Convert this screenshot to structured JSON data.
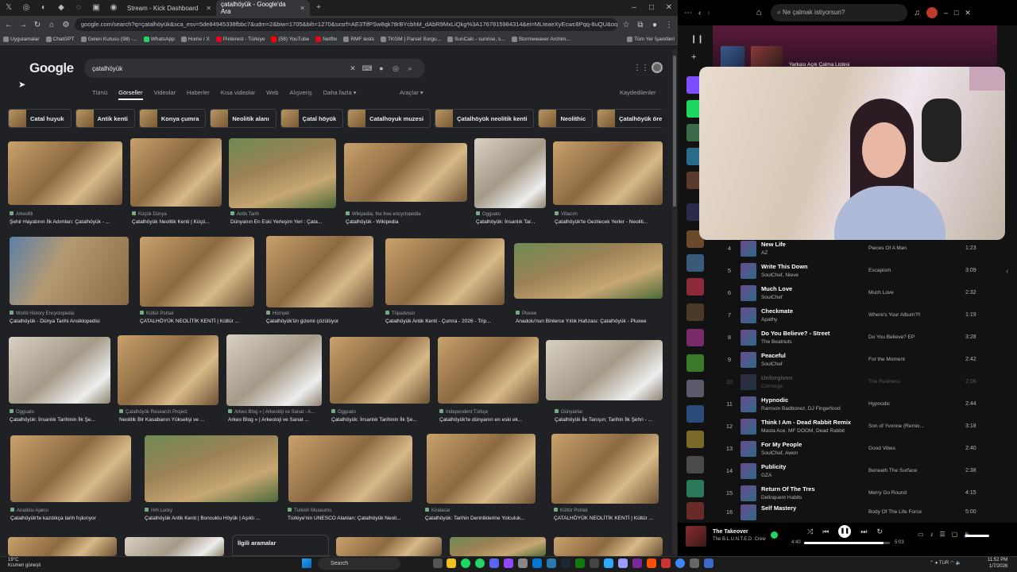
{
  "browser": {
    "tabs": [
      {
        "label": "Stream - Kick Dashboard"
      },
      {
        "label": "çatalhöyük - Google'da Ara"
      }
    ],
    "url": "google.com/search?q=çatalhöyük&sca_esv=5de84945338fbbc7&udm=2&biw=1705&bih=1270&sxsrf=AE3TifPSw8qk78rBYcbhM_dAbR9MxLiQkg%3A1767815984314&ei=MLteaeXyEcwc8Pqq-8uQU&oq=çatalh...",
    "bookmarks": [
      "Uygulamalar",
      "ChatGPT",
      "Gelen Kutusu (98) -...",
      "WhatsApp",
      "Home / X",
      "Pinterest - Türkiye",
      "(58) YouTube",
      "Netflix",
      "RMF tests",
      "TKGM | Parsel Sorgu...",
      "SunCalc - sunrise, s...",
      "Stormweaver Archim...",
      "Tüm Yer İşaretleri"
    ]
  },
  "google": {
    "logo": "Google",
    "query": "çatalhöyük",
    "tabs": [
      "Tümü",
      "Görseller",
      "Videolar",
      "Haberler",
      "Kısa videolar",
      "Web",
      "Alışveriş",
      "Daha fazla ▾"
    ],
    "tools": "Araçlar ▾",
    "saved": "Kaydedilenler",
    "chips": [
      "Catal huyuk",
      "Antik kenti",
      "Konya çumra",
      "Neolitik alanı",
      "Çatal höyük",
      "Catalhoyuk muzesi",
      "Çatalhöyük neolitik kenti",
      "Neolithic",
      "Çatalhöyük örenyeri"
    ],
    "results": [
      {
        "src": "Arkeofili",
        "title": "Şehir Hayatının İlk Adımları: Çatalhöyük - ..."
      },
      {
        "src": "Küçük Dünya",
        "title": "Çatalhöyük Neolitik Kenti | Küçü..."
      },
      {
        "src": "Antik Tarih",
        "title": "Dünyanın En Eski Yerleşim Yeri : Çata..."
      },
      {
        "src": "Wikipedia, the free encyclopedia",
        "title": "Çatalhöyük - Wikipedia"
      },
      {
        "src": "Ogguato",
        "title": "Çatalhöyük: İnsanlık Tar..."
      },
      {
        "src": "Villacım",
        "title": "Çatalhöyük'te Gezilecek Yerler - Neoliti..."
      },
      {
        "src": "World History Encyclopedia",
        "title": "Çatalhöyük - Dünya Tarihi Ansiklopedisi"
      },
      {
        "src": "Kültür Portalı",
        "title": "ÇATALHÖYÜK NEOLİTİK KENTİ | Kültür ..."
      },
      {
        "src": "Hürriyet",
        "title": "Çatalhöyük'ün gizemi çözülüyor"
      },
      {
        "src": "Tripadvisor",
        "title": "Çatalhöyük Antik Kenti - Çumra - 2026 - Trip..."
      },
      {
        "src": "Pluxee",
        "title": "Anadolu'nun Binlerce Yıllık Hafızası: Çatalhöyük - Pluxee"
      },
      {
        "src": "Ogguato",
        "title": "Çatalhöyük: İnsanlık Tarihinin İlk Şe..."
      },
      {
        "src": "Çatalhöyük Research Project",
        "title": "Neolitik Bir Kasabanın Yükselişi ve ..."
      },
      {
        "src": "Arkeo Blog » | Arkeoloji ve Sanat - A...",
        "title": "Arkeo Blog » | Arkeoloji ve Sanat ..."
      },
      {
        "src": "Ogguato",
        "title": "Çatalhöyük: İnsanlık Tarihinin İlk Şe..."
      },
      {
        "src": "Independent Türkçe",
        "title": "Çatalhöyük'te dünyanın en eski ek..."
      },
      {
        "src": "Günyalılar",
        "title": "Çatalhöyük İle Tanışın; Tarihin İlk Şehri - ..."
      },
      {
        "src": "Anadolu Ajansı",
        "title": "Çatalhöyük'te kazdıkça tarih fışkırıyor"
      },
      {
        "src": "Hrh Lucky",
        "title": "Çatalhöyük Antik Kenti | Boncuklu Höyük | Aşıklı ..."
      },
      {
        "src": "Turkish Museums",
        "title": "Türkiye'nin UNESCO Alanları: Çatalhöyük Neoli..."
      },
      {
        "src": "Kiralacar",
        "title": "Çatalhöyük: Tarihin Derinliklerine Yolculuk..."
      },
      {
        "src": "Kültür Portalı",
        "title": "ÇATALHÖYÜK NEOLİTİK KENTİ | Kültür ..."
      }
    ],
    "related": "İlgili aramalar"
  },
  "spotify": {
    "search_placeholder": "Ne çalmak istiyorsun?",
    "banner_text": "Yarkası Açık Çalma Listesi",
    "tracks": [
      {
        "n": "4",
        "title": "New Life",
        "artist": "AZ",
        "album": "Pieces Of A Man",
        "dur": "1:23"
      },
      {
        "n": "5",
        "title": "Write This Down",
        "artist": "SoulChef, Nieve",
        "album": "Escapism",
        "dur": "3:09"
      },
      {
        "n": "6",
        "title": "Much Love",
        "artist": "SoulChef",
        "album": "Much Love",
        "dur": "2:32"
      },
      {
        "n": "7",
        "title": "Checkmate",
        "artist": "Apathy",
        "album": "Where's Your Album?!!",
        "dur": "1:19"
      },
      {
        "n": "8",
        "title": "Do You Believe? - Street",
        "artist": "The Beatnuts",
        "album": "Do You Believe? EP",
        "dur": "3:28"
      },
      {
        "n": "9",
        "title": "Peaceful",
        "artist": "SoulChef",
        "album": "For the Moment",
        "dur": "2:42"
      },
      {
        "n": "10",
        "title": "Unforgiven",
        "artist": "Cormega",
        "album": "The Realness",
        "dur": "2:06"
      },
      {
        "n": "11",
        "title": "Hypnodic",
        "artist": "Ramson Badbonez, DJ Fingerfood",
        "album": "Hypnodic",
        "dur": "2:44"
      },
      {
        "n": "12",
        "title": "Think I Am - Dead Rabbit Remix",
        "artist": "Masta Ace, MF DOOM, Dead Rabbit",
        "album": "Son of Yvonne (Remix...",
        "dur": "3:18"
      },
      {
        "n": "13",
        "title": "For My People",
        "artist": "SoulChef, Awon",
        "album": "Good Vibes",
        "dur": "2:40"
      },
      {
        "n": "14",
        "title": "Publicity",
        "artist": "GZA",
        "album": "Beneath The Surface",
        "dur": "2:38"
      },
      {
        "n": "15",
        "title": "Return Of The Tres",
        "artist": "Delinquent Habits",
        "album": "Merry Go Round",
        "dur": "4:15"
      },
      {
        "n": "16",
        "title": "Self Mastery",
        "artist": "",
        "album": "Body Of The Life Force",
        "dur": "5:00"
      }
    ],
    "now_playing": {
      "title": "The Takeover",
      "artist": "The B.L.U.N.T.E.D. Crew",
      "current": "4:40",
      "total": "5:03",
      "progress": 0.93
    }
  },
  "taskbar": {
    "weather_temp": "19°C",
    "weather_desc": "Kısmen güneşli",
    "search": "Search",
    "lang": "TUR",
    "time": "11:52 PM",
    "date": "1/7/2026"
  }
}
